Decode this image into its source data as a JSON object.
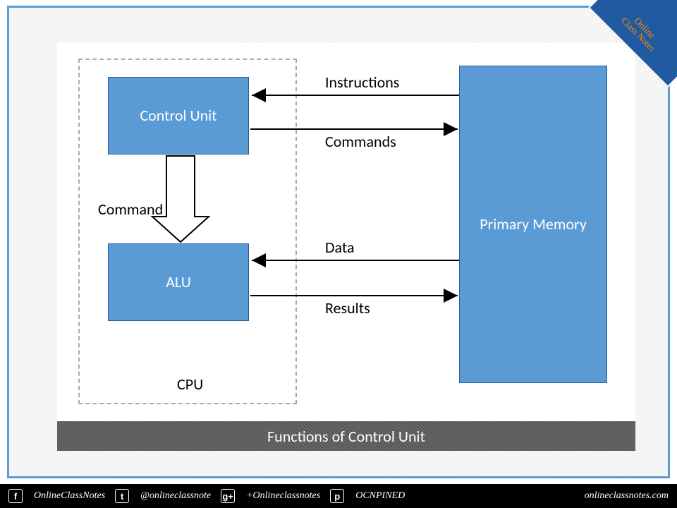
{
  "diagram": {
    "cpu_label": "CPU",
    "blocks": {
      "control_unit": "Control Unit",
      "alu": "ALU",
      "memory": "Primary Memory"
    },
    "arrows": {
      "instructions": "Instructions",
      "commands": "Commands",
      "data": "Data",
      "results": "Results",
      "command_down": "Command"
    },
    "caption": "Functions of Control Unit"
  },
  "brand": {
    "corner_line1": "Online",
    "corner_line2": "Class Notes"
  },
  "footer": {
    "facebook": {
      "icon": "f",
      "handle": "OnlineClassNotes"
    },
    "twitter": {
      "icon": "t",
      "handle": "@onlineclassnote"
    },
    "gplus": {
      "icon": "g+",
      "handle": "+Onlineclassnotes"
    },
    "pinterest": {
      "icon": "p",
      "handle": "OCNPINED"
    },
    "site": "onlineclassnotes.com"
  }
}
